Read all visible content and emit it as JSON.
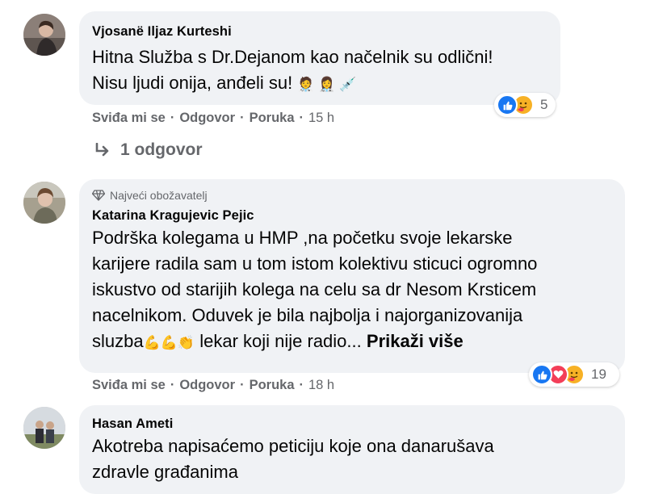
{
  "comments": [
    {
      "author": "Vjosanë Iljaz Kurteshi",
      "lines": [
        "Hitna Služba s Dr.Dejanom kao načelnik su odlični!",
        "Nisu ljudi onija, anđeli su!"
      ],
      "emojis": "🧑‍⚕️ 👩‍⚕️ 💉",
      "like": "Sviđa mi se",
      "reply": "Odgovor",
      "message": "Poruka",
      "time": "15 h",
      "reaction_count": "5",
      "replies": "1 odgovor"
    },
    {
      "badge": "Najveći obožavatelj",
      "author": "Katarina Kragujevic Pejic",
      "lines": [
        "Podrška kolegama u HMP ,na početku svoje lekarske",
        "karijere radila sam u tom istom kolektivu sticuci ogromno",
        "iskustvo od starijih kolega na celu sa dr Nesom Krsticem",
        "nacelnikom. Oduvek je bila najbolja i najorganizovanija"
      ],
      "last_line_start": "sluzba",
      "last_line_emojis": "💪💪👏",
      "last_line_end": " lekar koji nije radio...",
      "see_more": "Prikaži više",
      "like": "Sviđa mi se",
      "reply": "Odgovor",
      "message": "Poruka",
      "time": "18 h",
      "reaction_count": "19"
    },
    {
      "author": "Hasan Ameti",
      "lines": [
        "Akotreba napisaćemo peticiju koje ona danarušava",
        "zdravle građanima"
      ]
    }
  ],
  "separator": "·",
  "colors": {
    "bubble": "#f0f2f5",
    "meta": "#65676b",
    "like_blue": "#1877f2",
    "love_red": "#f33e58",
    "care_yellow": "#f7b125"
  }
}
